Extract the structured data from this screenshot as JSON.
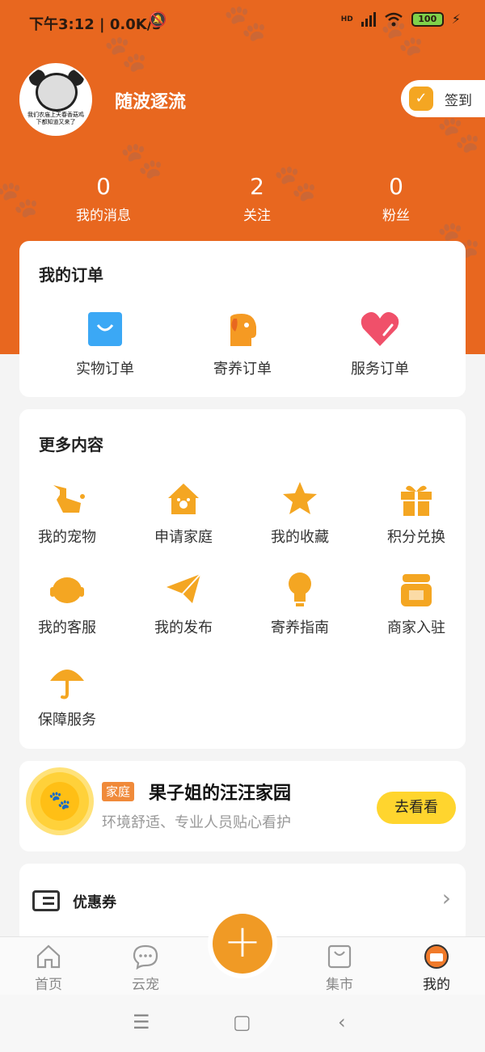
{
  "status_bar": {
    "time": "下午3:12 | 0.0K/s",
    "network": "HD",
    "battery": "100"
  },
  "profile": {
    "username": "随波逐流",
    "avatar_caption": "我们农庙上天春香菇鸡 下都知道又来了",
    "sign_in_label": "签到"
  },
  "stats": [
    {
      "value": "0",
      "label": "我的消息"
    },
    {
      "value": "2",
      "label": "关注"
    },
    {
      "value": "0",
      "label": "粉丝"
    }
  ],
  "orders": {
    "title": "我的订单",
    "items": [
      {
        "label": "实物订单",
        "icon": "shopping-bag-icon"
      },
      {
        "label": "寄养订单",
        "icon": "dog-icon"
      },
      {
        "label": "服务订单",
        "icon": "heart-icon"
      }
    ]
  },
  "more": {
    "title": "更多内容",
    "items": [
      {
        "label": "我的宠物",
        "icon": "dog-icon"
      },
      {
        "label": "申请家庭",
        "icon": "house-icon"
      },
      {
        "label": "我的收藏",
        "icon": "star-icon"
      },
      {
        "label": "积分兑换",
        "icon": "gift-icon"
      },
      {
        "label": "我的客服",
        "icon": "headset-icon"
      },
      {
        "label": "我的发布",
        "icon": "paper-plane-icon"
      },
      {
        "label": "寄养指南",
        "icon": "lightbulb-icon"
      },
      {
        "label": "商家入驻",
        "icon": "shop-icon"
      },
      {
        "label": "保障服务",
        "icon": "umbrella-icon"
      }
    ]
  },
  "promo": {
    "tag": "家庭",
    "title": "果子姐的汪汪家园",
    "desc": "环境舒适、专业人员贴心看护",
    "button": "去看看"
  },
  "coupon": {
    "label": "优惠券"
  },
  "tabbar": [
    {
      "label": "首页",
      "icon": "home-icon"
    },
    {
      "label": "云宠",
      "icon": "chat-icon"
    },
    {
      "label": "集市",
      "icon": "bag-icon"
    },
    {
      "label": "我的",
      "icon": "profile-icon"
    }
  ],
  "colors": {
    "brand": "#e8671f",
    "accent": "#f4a622",
    "button_yellow": "#ffd52e"
  }
}
